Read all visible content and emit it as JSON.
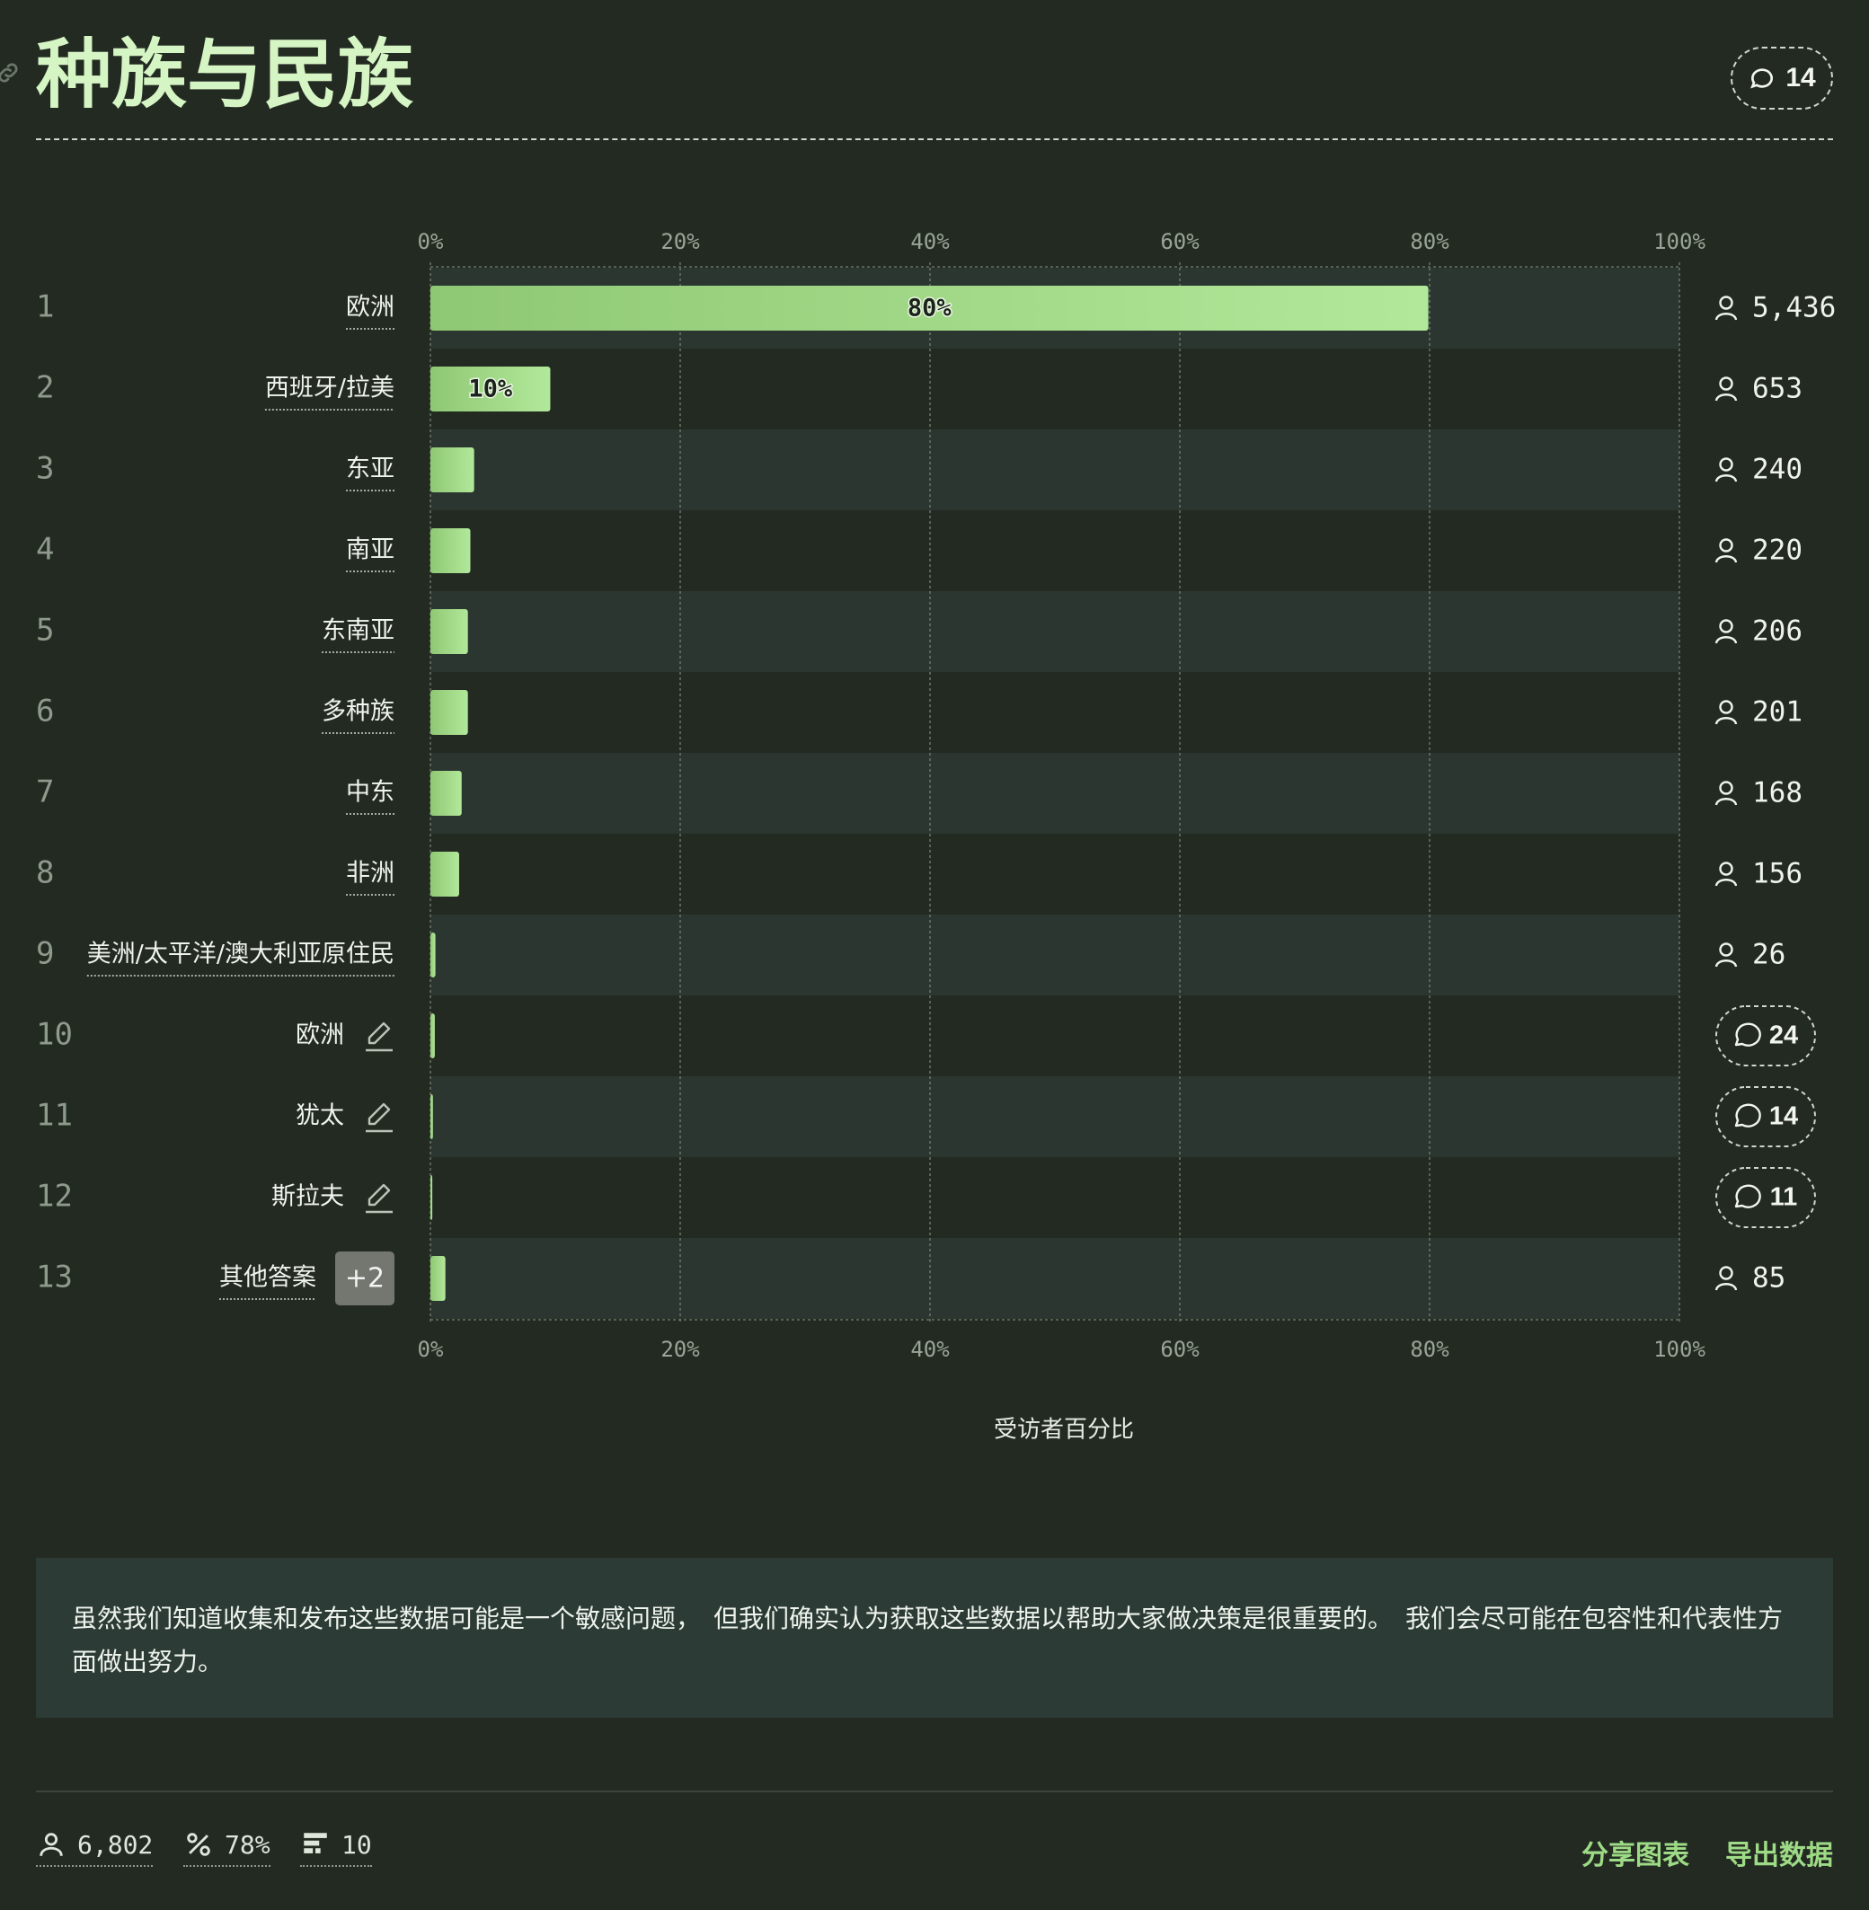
{
  "page": {
    "title": "种族与民族",
    "title_comment_count": "14",
    "note": "虽然我们知道收集和发布这些数据可能是一个敏感问题，　但我们确实认为获取这些数据以帮助大家做决策是很重要的。　我们会尽可能在包容性和代表性方面做出努力。",
    "stats": {
      "respondents": "6,802",
      "percent": "78%",
      "questions": "10"
    },
    "actions": {
      "share": "分享图表",
      "export": "导出数据"
    }
  },
  "chart_data": {
    "type": "bar",
    "orientation": "horizontal",
    "title": "种族与民族",
    "xlabel": "受访者百分比",
    "xlim": [
      0,
      100
    ],
    "ticks": [
      "0%",
      "20%",
      "40%",
      "60%",
      "80%",
      "100%"
    ],
    "tick_values": [
      0,
      20,
      40,
      60,
      80,
      100
    ],
    "grid": true,
    "rows": [
      {
        "rank": "1",
        "category": "欧洲",
        "value": 79.9,
        "label": "80%",
        "count": "5,436"
      },
      {
        "rank": "2",
        "category": "西班牙/拉美",
        "value": 9.6,
        "label": "10%",
        "count": "653"
      },
      {
        "rank": "3",
        "category": "东亚",
        "value": 3.5,
        "count": "240"
      },
      {
        "rank": "4",
        "category": "南亚",
        "value": 3.2,
        "count": "220"
      },
      {
        "rank": "5",
        "category": "东南亚",
        "value": 3.0,
        "count": "206"
      },
      {
        "rank": "6",
        "category": "多种族",
        "value": 3.0,
        "count": "201"
      },
      {
        "rank": "7",
        "category": "中东",
        "value": 2.5,
        "count": "168"
      },
      {
        "rank": "8",
        "category": "非洲",
        "value": 2.3,
        "count": "156"
      },
      {
        "rank": "9",
        "category": "美洲/太平洋/澳大利亚原住民",
        "value": 0.4,
        "count": "26"
      },
      {
        "rank": "10",
        "category": "欧洲",
        "value": 0.35,
        "comments": "24",
        "editable": true
      },
      {
        "rank": "11",
        "category": "犹太",
        "value": 0.2,
        "comments": "14",
        "editable": true
      },
      {
        "rank": "12",
        "category": "斯拉夫",
        "value": 0.15,
        "comments": "11",
        "editable": true
      },
      {
        "rank": "13",
        "category": "其他答案",
        "value": 1.2,
        "count": "85",
        "extra": "+2"
      }
    ],
    "colors": {
      "bar_start": "#8fc874",
      "bar_end": "#b2e89a",
      "row_alt": "#2b3630",
      "background": "#232a22"
    }
  }
}
